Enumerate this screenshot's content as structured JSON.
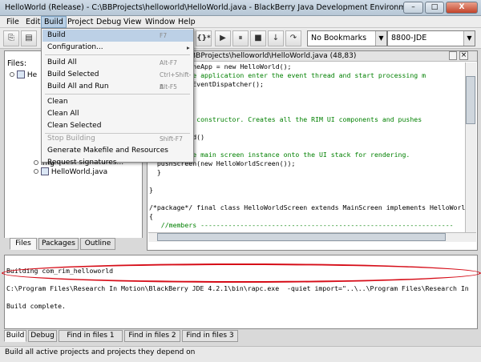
{
  "window": {
    "title": "HelloWorld (Release) - C:\\BBProjects\\helloworld\\HelloWorld.java - BlackBerry Java Development Environment",
    "min": "–",
    "max": "□",
    "close": "X"
  },
  "menubar": {
    "items": [
      "File",
      "Edit",
      "Build",
      "Project",
      "Debug",
      "View",
      "Window",
      "Help"
    ]
  },
  "toolbar": {
    "braces": "{}*",
    "bookmarks": "No Bookmarks",
    "device": "8800-JDE"
  },
  "build_menu": {
    "items": [
      {
        "label": "Build",
        "shortcut": "F7"
      },
      {
        "label": "Configuration...",
        "shortcut": ""
      },
      {
        "label": "Build All",
        "shortcut": "Alt-F7"
      },
      {
        "label": "Build Selected",
        "shortcut": "Ctrl+Shift-B"
      },
      {
        "label": "Build All and Run",
        "shortcut": "Alt-F5"
      },
      {
        "label": "Clean",
        "shortcut": ""
      },
      {
        "label": "Clean All",
        "shortcut": ""
      },
      {
        "label": "Clean Selected",
        "shortcut": ""
      },
      {
        "label": "Stop Building",
        "shortcut": "Shift-F7"
      },
      {
        "label": "Generate Makefile and Resources",
        "shortcut": ""
      },
      {
        "label": "Request signatures...",
        "shortcut": ""
      }
    ]
  },
  "left_panel": {
    "label": "Files:",
    "tree": [
      "He",
      "img",
      "HelloWorld.java"
    ],
    "tabs": [
      "Files",
      "Packages",
      "Outline"
    ]
  },
  "editor": {
    "title": "BBProjects\\helloworld\\HelloWorld.java (48,83)",
    "close": "×",
    "lines": [
      "elloWorld theApp = new HelloWorld();",
      "/To make the application enter the event thread and start processing m",
      "heApp.enterEventDispatcher();",
      "",
      "",
      "",
      "the default constructor. Creates all the RIM UI components and pushes",
      "",
      "  HelloWorld()",
      "",
      "  //Push the main screen instance onto the UI stack for rendering.",
      "  pushScreen(new HelloWorldScreen());",
      "  }",
      "",
      "}",
      "",
      "/*package*/ final class HelloWorldScreen extends MainScreen implements HelloWorl",
      "{",
      "   //members ----------------------------------------------------------------"
    ]
  },
  "output": {
    "lines": [
      "Building com_rim_helloworld",
      "C:\\Program Files\\Research In Motion\\BlackBerry JDE 4.2.1\\bin\\rapc.exe  -quiet import=\"..\\..\\Program Files\\Research In",
      "Build complete."
    ],
    "tabs": [
      "Build",
      "Debug",
      "Find in files 1",
      "Find in files 2",
      "Find in files 3"
    ]
  },
  "status": {
    "text": "Build all active projects and projects they depend on"
  },
  "colors": {
    "menu_highlight": "#bcd0e6",
    "annotation": "#d60d18"
  }
}
